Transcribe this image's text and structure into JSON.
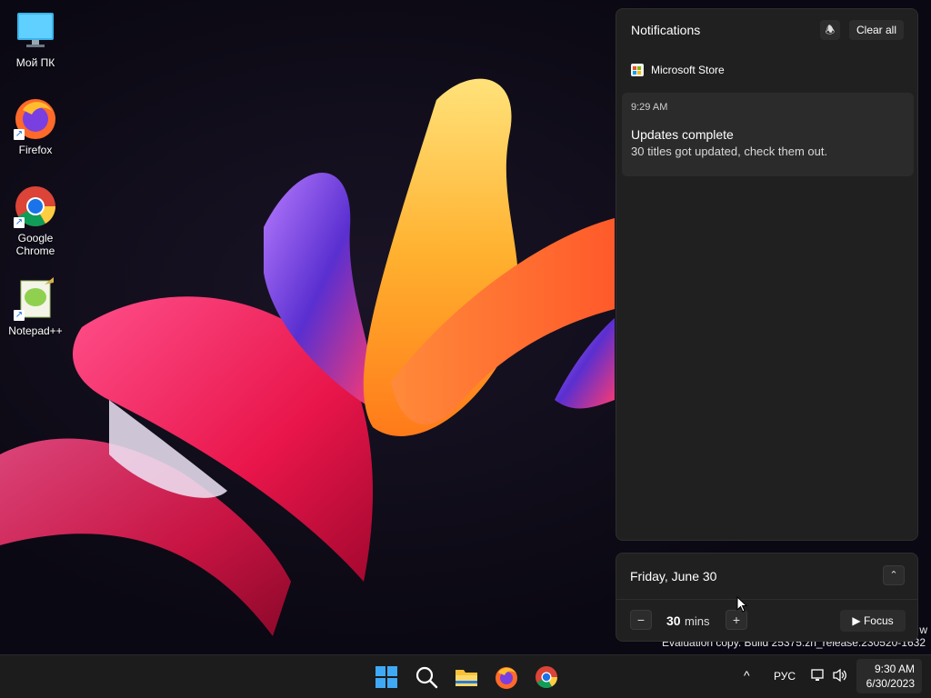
{
  "desktop": {
    "icons": [
      {
        "label": "Мой ПК",
        "icon": "computer-icon"
      },
      {
        "label": "Firefox",
        "icon": "firefox-icon"
      },
      {
        "label": "Google Chrome",
        "icon": "chrome-icon"
      },
      {
        "label": "Notepad++",
        "icon": "notepadpp-icon"
      }
    ]
  },
  "watermark": {
    "line": "Evaluation copy. Build 25375.zn_release.230520-1632",
    "partial": "w"
  },
  "notifications": {
    "title": "Notifications",
    "clear_all": "Clear all",
    "dnd_icon": "do-not-disturb-icon",
    "app_name": "Microsoft Store",
    "toast": {
      "time": "9:29 AM",
      "title": "Updates complete",
      "body": "30 titles got updated, check them out."
    }
  },
  "focus": {
    "date": "Friday, June 30",
    "minutes": "30",
    "unit": "mins",
    "minus": "−",
    "plus": "+",
    "focus_label": "Focus",
    "collapse_icon": "chevron-up-icon"
  },
  "taskbar": {
    "apps": [
      "start-icon",
      "search-icon",
      "file-explorer-icon",
      "firefox-icon",
      "chrome-icon"
    ],
    "tray": {
      "chevron": "^",
      "language": "РУС",
      "time": "9:30 AM",
      "date": "6/30/2023"
    }
  },
  "colors": {
    "panel_bg": "#202020",
    "toast_bg": "#2b2b2b",
    "taskbar_bg": "#1c1c1c",
    "accent_blue": "#1a86ff"
  }
}
